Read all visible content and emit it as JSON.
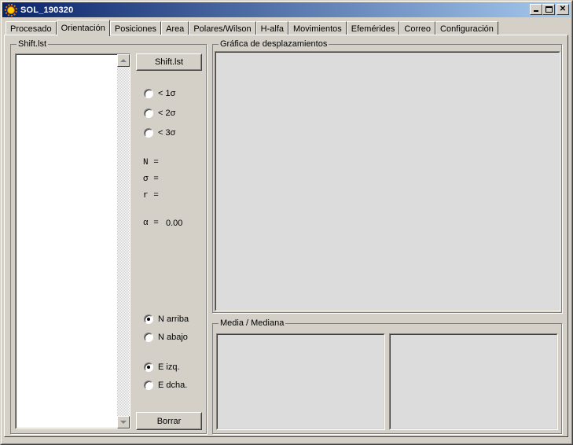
{
  "window": {
    "title": "SOL_190320",
    "minimize_glyph": "_",
    "maximize_glyph": "□",
    "close_glyph": "✕"
  },
  "tabs": [
    {
      "label": "Procesado"
    },
    {
      "label": "Orientación"
    },
    {
      "label": "Posiciones"
    },
    {
      "label": "Area"
    },
    {
      "label": "Polares/Wilson"
    },
    {
      "label": "H-alfa"
    },
    {
      "label": "Movimientos"
    },
    {
      "label": "Efemérides"
    },
    {
      "label": "Correo"
    },
    {
      "label": "Configuración"
    }
  ],
  "active_tab": "Orientación",
  "shift_group": {
    "label": "Shift.lst",
    "load_button": "Shift.lst",
    "clear_button": "Borrar",
    "sigma_options": [
      {
        "label": "< 1σ",
        "checked": false
      },
      {
        "label": "< 2σ",
        "checked": false
      },
      {
        "label": "< 3σ",
        "checked": false
      }
    ],
    "stats": {
      "n_label": "N =",
      "sigma_label": "σ =",
      "r_label": "r =",
      "alpha_label": "α =",
      "alpha_value": "0.00"
    },
    "north_options": [
      {
        "label": "N arriba",
        "checked": true
      },
      {
        "label": "N abajo",
        "checked": false
      }
    ],
    "east_options": [
      {
        "label": "E izq.",
        "checked": true
      },
      {
        "label": "E dcha.",
        "checked": false
      }
    ]
  },
  "displacement_group": {
    "label": "Gráfica de desplazamientos"
  },
  "median_group": {
    "label": "Media / Mediana"
  }
}
